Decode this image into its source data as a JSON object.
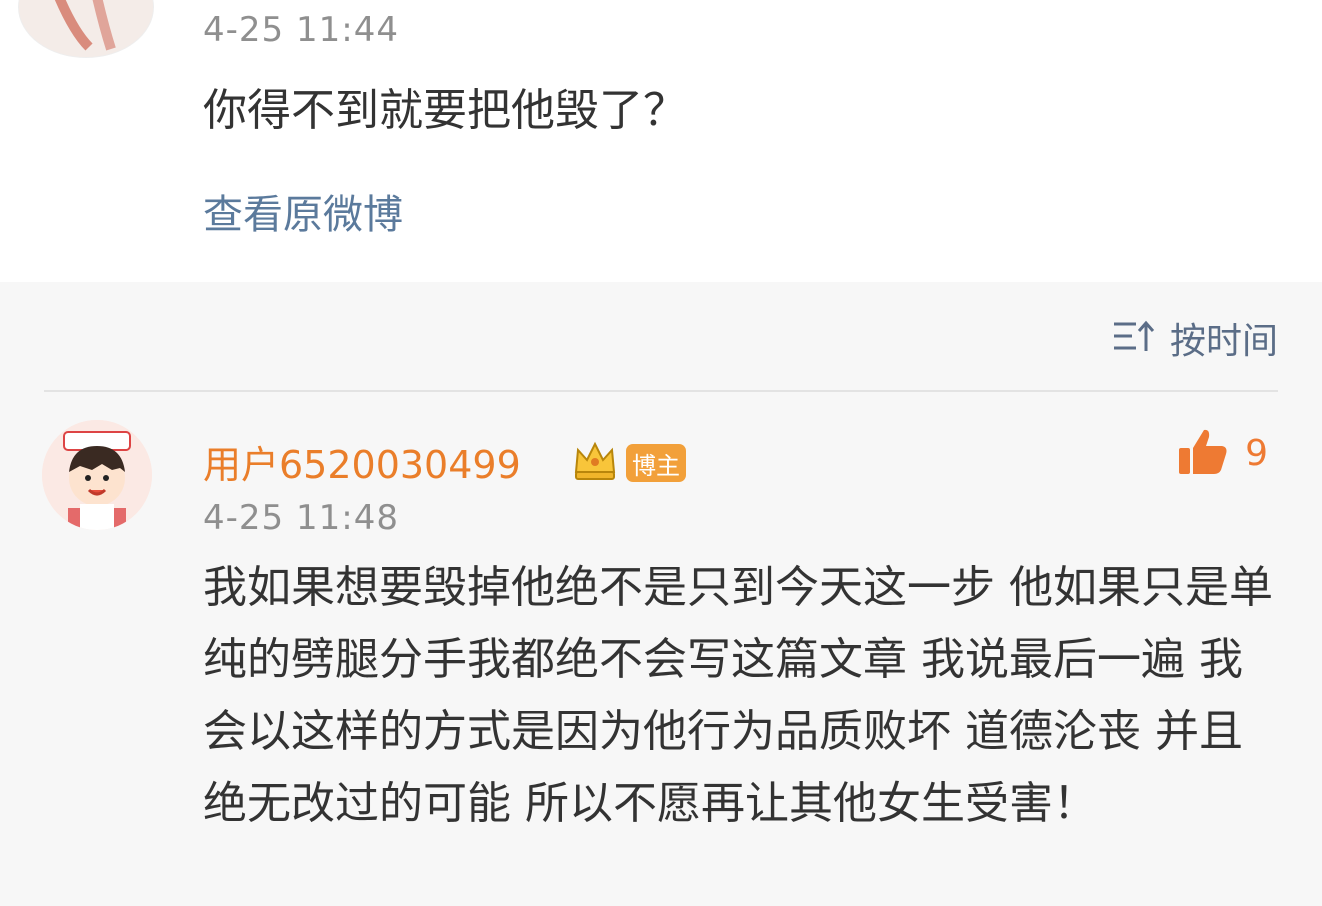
{
  "original_post": {
    "time": "4-25 11:44",
    "text": "你得不到就要把他毁了？",
    "view_link": "查看原微博"
  },
  "sort": {
    "label": "按时间",
    "icon": "sort-order-icon"
  },
  "comment": {
    "username": "用户6520030499",
    "badge": "博主",
    "vip_icon": "crown-icon",
    "likes": "9",
    "time": "4-25 11:48",
    "text": "我如果想要毁掉他绝不是只到今天这一步 他如果只是单纯的劈腿分手我都绝不会写这篇文章 我说最后一遍 我会以这样的方式是因为他行为品质败坏 道德沦丧 并且绝无改过的可能 所以不愿再让其他女生受害！"
  },
  "colors": {
    "username": "#ea7e2a",
    "link": "#5b7a9c",
    "badge_bg": "#f2a03a",
    "like": "#ee7a33"
  }
}
